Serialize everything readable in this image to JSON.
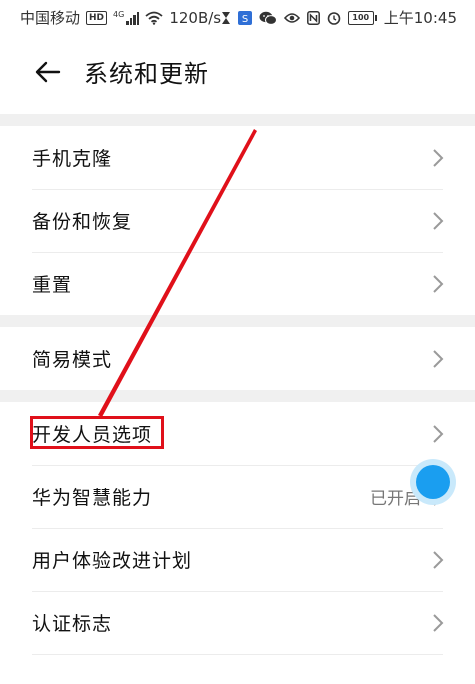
{
  "status_bar": {
    "carrier": "中国移动",
    "hd_badge": "HD",
    "network_type": "4G",
    "speed": "120B/s",
    "battery_level": "100",
    "time": "上午10:45"
  },
  "header": {
    "title": "系统和更新",
    "back_icon": "arrow-left-icon"
  },
  "list": {
    "group1": [
      {
        "label": "手机克隆"
      },
      {
        "label": "备份和恢复"
      },
      {
        "label": "重置"
      }
    ],
    "group2": [
      {
        "label": "简易模式"
      }
    ],
    "group3": [
      {
        "label": "开发人员选项",
        "highlighted": true
      },
      {
        "label": "华为智慧能力",
        "value": "已开启"
      },
      {
        "label": "用户体验改进计划"
      },
      {
        "label": "认证标志"
      }
    ]
  },
  "annotation": {
    "color": "#e0101a",
    "highlight_color": "#e0101a"
  },
  "float_ball": {
    "color": "#1a9ef0"
  }
}
